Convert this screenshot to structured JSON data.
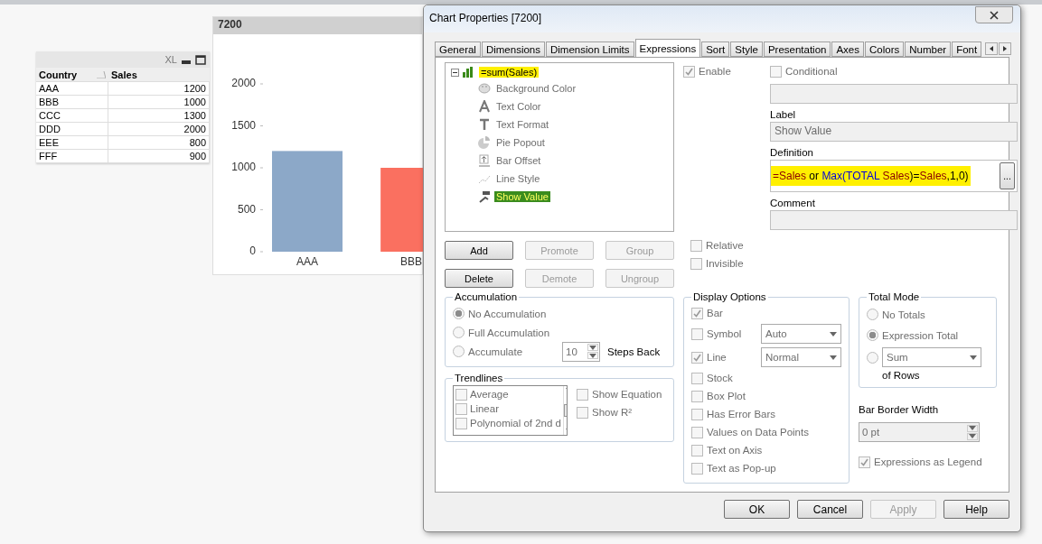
{
  "table_box": {
    "toolbar_label": "XL",
    "columns": [
      {
        "label": "Country",
        "sorted": true
      },
      {
        "label": "Sales",
        "sorted": false
      }
    ],
    "rows": [
      [
        "AAA",
        "1200"
      ],
      [
        "BBB",
        "1000"
      ],
      [
        "CCC",
        "1300"
      ],
      [
        "DDD",
        "2000"
      ],
      [
        "EEE",
        "800"
      ],
      [
        "FFF",
        "900"
      ]
    ]
  },
  "chart_window": {
    "title": "7200",
    "chart_data": {
      "type": "bar",
      "categories": [
        "AAA",
        "BBB"
      ],
      "values": [
        1200,
        1000
      ],
      "ylim": [
        0,
        2000
      ],
      "yticks": [
        0,
        500,
        1000,
        1500,
        2000
      ],
      "colors": [
        "#8ca8c8",
        "#fa7060"
      ]
    }
  },
  "dialog": {
    "title": "Chart Properties [7200]",
    "tabs": [
      {
        "label": "General",
        "selected": false
      },
      {
        "label": "Dimensions",
        "selected": false
      },
      {
        "label": "Dimension Limits",
        "selected": false
      },
      {
        "label": "Expressions",
        "selected": true
      },
      {
        "label": "Sort",
        "selected": false
      },
      {
        "label": "Style",
        "selected": false
      },
      {
        "label": "Presentation",
        "selected": false
      },
      {
        "label": "Axes",
        "selected": false
      },
      {
        "label": "Colors",
        "selected": false
      },
      {
        "label": "Number",
        "selected": false
      },
      {
        "label": "Font",
        "selected": false
      }
    ],
    "expression_tree": {
      "label": "=sum(Sales)",
      "expanded": true,
      "highlighted": true,
      "children": [
        {
          "kind": "background-color",
          "label": "Background Color",
          "selected": false,
          "highlighted": false
        },
        {
          "kind": "text-color",
          "label": "Text Color",
          "selected": false,
          "highlighted": false
        },
        {
          "kind": "text-format",
          "label": "Text Format",
          "selected": false,
          "highlighted": false
        },
        {
          "kind": "pie-popout",
          "label": "Pie Popout",
          "selected": false,
          "highlighted": false
        },
        {
          "kind": "bar-offset",
          "label": "Bar Offset",
          "selected": false,
          "highlighted": false
        },
        {
          "kind": "line-style",
          "label": "Line Style",
          "selected": false,
          "highlighted": false
        },
        {
          "kind": "show-value",
          "label": "Show Value",
          "selected": true,
          "highlighted": true
        }
      ]
    },
    "tree_buttons": [
      {
        "label": "Add",
        "disabled": false
      },
      {
        "label": "Promote",
        "disabled": true
      },
      {
        "label": "Group",
        "disabled": true
      },
      {
        "label": "Delete",
        "disabled": false
      },
      {
        "label": "Demote",
        "disabled": true
      },
      {
        "label": "Ungroup",
        "disabled": true
      }
    ],
    "enable": {
      "label": "Enable",
      "checked": true,
      "disabled": true
    },
    "relative": {
      "label": "Relative",
      "checked": false,
      "disabled": true
    },
    "invisible": {
      "label": "Invisible",
      "checked": false,
      "disabled": true
    },
    "conditional": {
      "label": "Conditional",
      "checked": false,
      "disabled": true
    },
    "label_field": {
      "label": "Label",
      "value": "Show Value"
    },
    "definition_field": {
      "label": "Definition",
      "highlighted": true,
      "button": "...",
      "segments": [
        {
          "kind": "field",
          "text": "=Sales"
        },
        {
          "kind": "plain",
          "text": " or "
        },
        {
          "kind": "function",
          "text": "Max(TOTAL "
        },
        {
          "kind": "field",
          "text": "Sales"
        },
        {
          "kind": "plain",
          "text": ")="
        },
        {
          "kind": "field",
          "text": "Sales"
        },
        {
          "kind": "plain",
          "text": ",1,0)"
        }
      ]
    },
    "comment_field": {
      "label": "Comment"
    },
    "accumulation": {
      "title": "Accumulation",
      "options": [
        {
          "label": "No Accumulation",
          "selected": true
        },
        {
          "label": "Full Accumulation",
          "selected": false
        },
        {
          "label": "Accumulate",
          "selected": false
        }
      ],
      "steps": "10",
      "steps_label": "Steps Back"
    },
    "trendlines": {
      "title": "Trendlines",
      "items": [
        {
          "label": "Average",
          "checked": false
        },
        {
          "label": "Linear",
          "checked": false
        },
        {
          "label": "Polynomial of 2nd d",
          "checked": false
        }
      ],
      "options": [
        {
          "label": "Show Equation",
          "checked": false
        },
        {
          "label": "Show R²",
          "checked": false
        }
      ]
    },
    "display_options": {
      "title": "Display Options",
      "items": [
        {
          "kind": "check",
          "label": "Bar",
          "checked": true,
          "disabled": true
        },
        {
          "kind": "check-dropdown",
          "label": "Symbol",
          "checked": false,
          "disabled": true,
          "value": "Auto"
        },
        {
          "kind": "check-dropdown",
          "label": "Line",
          "checked": true,
          "disabled": true,
          "value": "Normal"
        },
        {
          "kind": "check",
          "label": "Stock",
          "checked": false,
          "disabled": true
        },
        {
          "kind": "check",
          "label": "Box Plot",
          "checked": false,
          "disabled": true
        },
        {
          "kind": "check",
          "label": "Has Error Bars",
          "checked": false,
          "disabled": true
        },
        {
          "kind": "check",
          "label": "Values on Data Points",
          "checked": false,
          "disabled": true
        },
        {
          "kind": "check",
          "label": "Text on Axis",
          "checked": false,
          "disabled": true
        },
        {
          "kind": "check",
          "label": "Text as Pop-up",
          "checked": false,
          "disabled": true
        }
      ]
    },
    "total_mode": {
      "title": "Total Mode",
      "options": [
        {
          "kind": "radio",
          "label": "No Totals",
          "selected": false
        },
        {
          "kind": "radio",
          "label": "Expression Total",
          "selected": true
        },
        {
          "kind": "radio-dropdown",
          "value": "Sum",
          "selected": false
        }
      ],
      "suffix": "of Rows"
    },
    "bar_border_width": {
      "label": "Bar Border Width",
      "value": "0 pt"
    },
    "expressions_as_legend": {
      "label": "Expressions as Legend",
      "checked": true,
      "disabled": true
    },
    "buttons": [
      {
        "label": "OK",
        "disabled": false
      },
      {
        "label": "Cancel",
        "disabled": false
      },
      {
        "label": "Apply",
        "disabled": true
      },
      {
        "label": "Help",
        "disabled": false
      }
    ]
  }
}
